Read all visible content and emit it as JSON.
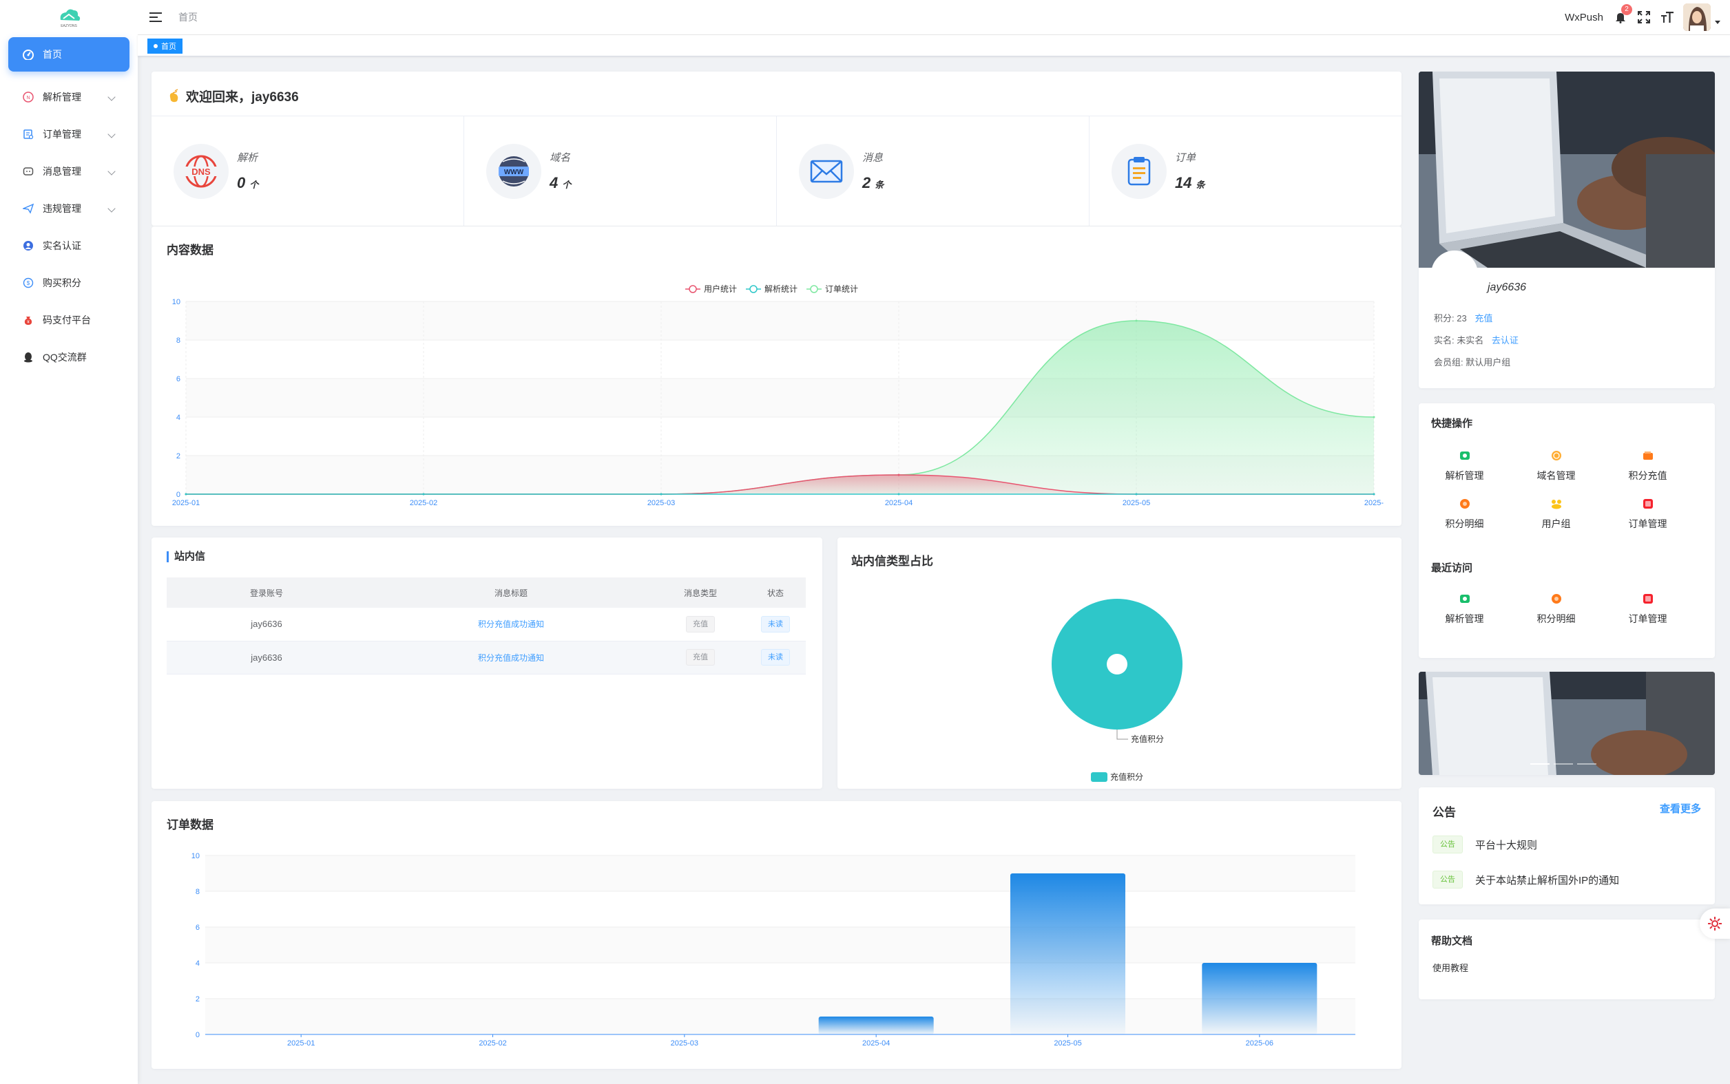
{
  "sidebar": {
    "logo_text": "EAZYDNS",
    "items": [
      {
        "label": "首页",
        "icon": "dashboard-icon",
        "active": true,
        "has_children": false
      },
      {
        "label": "解析管理",
        "icon": "dns-icon",
        "has_children": true
      },
      {
        "label": "订单管理",
        "icon": "order-icon",
        "has_children": true
      },
      {
        "label": "消息管理",
        "icon": "message-icon",
        "has_children": true
      },
      {
        "label": "违规管理",
        "icon": "send-icon",
        "has_children": true
      },
      {
        "label": "实名认证",
        "icon": "user-badge-icon",
        "has_children": false
      },
      {
        "label": "购买积分",
        "icon": "coin-icon",
        "has_children": false
      },
      {
        "label": "码支付平台",
        "icon": "moneybag-icon",
        "has_children": false
      },
      {
        "label": "QQ交流群",
        "icon": "qq-icon",
        "has_children": false
      }
    ]
  },
  "header": {
    "breadcrumb": "首页",
    "wxpush": "WxPush",
    "notification_count": "2",
    "icons": [
      "bell-icon",
      "fullscreen-icon",
      "font-size-icon",
      "avatar"
    ]
  },
  "tags": {
    "active": "首页"
  },
  "welcome": {
    "title": "欢迎回来，jay6636",
    "stats": [
      {
        "label": "解析",
        "value": "0",
        "unit": "个",
        "icon": "dns-stat-icon"
      },
      {
        "label": "域名",
        "value": "4",
        "unit": "个",
        "icon": "www-stat-icon"
      },
      {
        "label": "消息",
        "value": "2",
        "unit": "条",
        "icon": "mail-stat-icon"
      },
      {
        "label": "订单",
        "value": "14",
        "unit": "条",
        "icon": "clipboard-stat-icon"
      }
    ]
  },
  "content_chart": {
    "title": "内容数据",
    "legend": [
      "用户统计",
      "解析统计",
      "订单统计"
    ]
  },
  "station_msgs": {
    "title": "站内信",
    "columns": [
      "登录账号",
      "消息标题",
      "消息类型",
      "状态"
    ],
    "rows": [
      {
        "account": "jay6636",
        "title": "积分充值成功通知",
        "type": "充值",
        "status": "未读"
      },
      {
        "account": "jay6636",
        "title": "积分充值成功通知",
        "type": "充值",
        "status": "未读"
      }
    ]
  },
  "pie": {
    "title": "站内信类型占比",
    "slice_label": "充值积分",
    "legend": "充值积分"
  },
  "order_chart": {
    "title": "订单数据"
  },
  "profile": {
    "name": "jay6636",
    "points_label": "积分:",
    "points": "23",
    "recharge": "充值",
    "realname_label": "实名:",
    "realname": "未实名",
    "verify": "去认证",
    "group_label": "会员组:",
    "group": "默认用户组"
  },
  "quick_ops": {
    "title": "快捷操作",
    "items": [
      {
        "label": "解析管理",
        "icon": "dns-quick-icon",
        "color": "#19be6b"
      },
      {
        "label": "域名管理",
        "icon": "globe-quick-icon",
        "color": "#ff9900"
      },
      {
        "label": "积分充值",
        "icon": "wallet-quick-icon",
        "color": "#ff7a1a"
      },
      {
        "label": "积分明细",
        "icon": "coin-quick-icon",
        "color": "#ff7a1a"
      },
      {
        "label": "用户组",
        "icon": "users-quick-icon",
        "color": "#fcc419"
      },
      {
        "label": "订单管理",
        "icon": "order-quick-icon",
        "color": "#f5222d"
      }
    ]
  },
  "recent": {
    "title": "最近访问",
    "items": [
      {
        "label": "解析管理",
        "icon": "dns-recent-icon",
        "color": "#19be6b"
      },
      {
        "label": "积分明细",
        "icon": "coin-recent-icon",
        "color": "#ff7a1a"
      },
      {
        "label": "订单管理",
        "icon": "order-recent-icon",
        "color": "#f5222d"
      }
    ]
  },
  "notice": {
    "title": "公告",
    "more": "查看更多",
    "items": [
      {
        "tag": "公告",
        "text": "平台十大规则"
      },
      {
        "tag": "公告",
        "text": "关于本站禁止解析国外IP的通知"
      }
    ]
  },
  "help": {
    "title": "帮助文档",
    "link": "使用教程"
  },
  "colors": {
    "primary": "#3c8df7",
    "user": "#e8546f",
    "parse": "#2ec7c9",
    "order": "#7ee8a1",
    "bar": "#1e88e5",
    "pie": "#2ec7c9"
  },
  "chart_data": [
    {
      "type": "area",
      "title": "内容数据",
      "categories": [
        "2025-01",
        "2025-02",
        "2025-03",
        "2025-04",
        "2025-05",
        "2025-06"
      ],
      "series": [
        {
          "name": "用户统计",
          "values": [
            0,
            0,
            0,
            1,
            0,
            0
          ]
        },
        {
          "name": "解析统计",
          "values": [
            0,
            0,
            0,
            0,
            0,
            0
          ]
        },
        {
          "name": "订单统计",
          "values": [
            0,
            0,
            0,
            1,
            9,
            4
          ]
        }
      ],
      "ylim": [
        0,
        10
      ],
      "yticks": [
        0,
        2,
        4,
        6,
        8,
        10
      ],
      "xtick_labels": [
        "2025-01",
        "2025-02",
        "2025-03",
        "2025-04",
        "2025-05",
        "2025-"
      ],
      "legend": "top-center",
      "grid": true
    },
    {
      "type": "pie",
      "title": "站内信类型占比",
      "slices": [
        {
          "name": "充值积分",
          "value": 2
        }
      ],
      "legend": "bottom-center"
    },
    {
      "type": "bar",
      "title": "订单数据",
      "categories": [
        "2025-01",
        "2025-02",
        "2025-03",
        "2025-04",
        "2025-05",
        "2025-06"
      ],
      "values": [
        0,
        0,
        0,
        1,
        9,
        4
      ],
      "ylim": [
        0,
        10
      ],
      "yticks": [
        0,
        2,
        4,
        6,
        8,
        10
      ],
      "grid": true
    }
  ]
}
